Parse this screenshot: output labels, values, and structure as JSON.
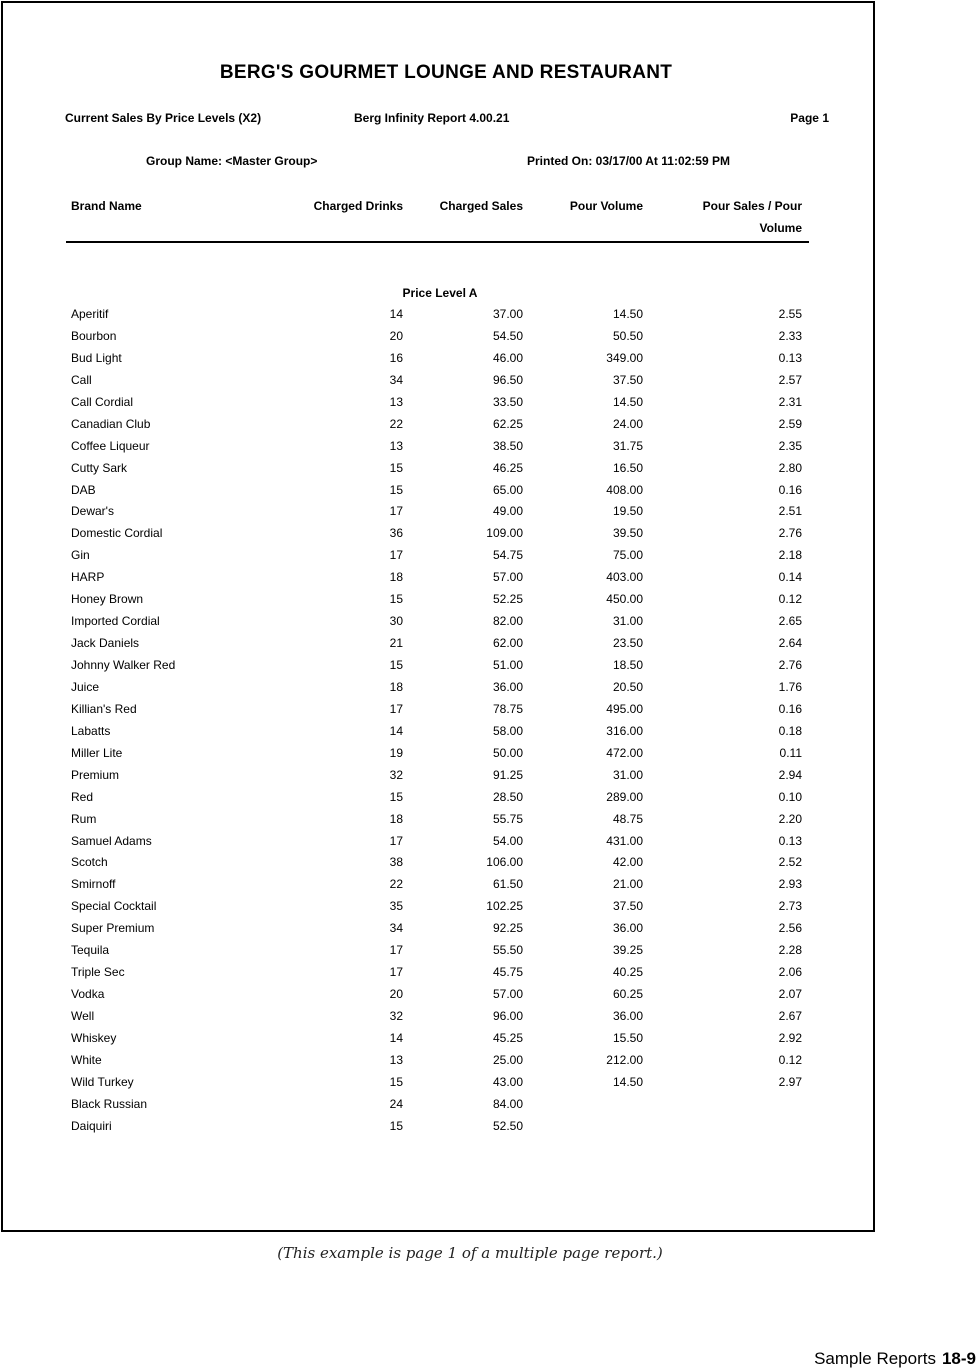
{
  "report": {
    "title": "BERG'S GOURMET LOUNGE AND RESTAURANT",
    "subtitle": "Current Sales By Price Levels (X2)",
    "software": "Berg Infinity Report 4.00.21",
    "page": "Page 1",
    "group_name": "Group Name: <Master Group>",
    "printed_on": "Printed On: 03/17/00 At 11:02:59 PM"
  },
  "table": {
    "columns": [
      "Brand Name",
      "Charged Drinks",
      "Charged Sales",
      "Pour Volume",
      "Pour Sales / Pour",
      "Volume"
    ],
    "section": "Price Level A",
    "rows": [
      {
        "name": "Aperitif",
        "drinks": "14",
        "sales": "37.00",
        "volume": "14.50",
        "ratio": "2.55"
      },
      {
        "name": "Bourbon",
        "drinks": "20",
        "sales": "54.50",
        "volume": "50.50",
        "ratio": "2.33"
      },
      {
        "name": "Bud Light",
        "drinks": "16",
        "sales": "46.00",
        "volume": "349.00",
        "ratio": "0.13"
      },
      {
        "name": "Call",
        "drinks": "34",
        "sales": "96.50",
        "volume": "37.50",
        "ratio": "2.57"
      },
      {
        "name": "Call Cordial",
        "drinks": "13",
        "sales": "33.50",
        "volume": "14.50",
        "ratio": "2.31"
      },
      {
        "name": "Canadian Club",
        "drinks": "22",
        "sales": "62.25",
        "volume": "24.00",
        "ratio": "2.59"
      },
      {
        "name": "Coffee Liqueur",
        "drinks": "13",
        "sales": "38.50",
        "volume": "31.75",
        "ratio": "2.35"
      },
      {
        "name": "Cutty Sark",
        "drinks": "15",
        "sales": "46.25",
        "volume": "16.50",
        "ratio": "2.80"
      },
      {
        "name": "DAB",
        "drinks": "15",
        "sales": "65.00",
        "volume": "408.00",
        "ratio": "0.16"
      },
      {
        "name": "Dewar's",
        "drinks": "17",
        "sales": "49.00",
        "volume": "19.50",
        "ratio": "2.51"
      },
      {
        "name": "Domestic Cordial",
        "drinks": "36",
        "sales": "109.00",
        "volume": "39.50",
        "ratio": "2.76"
      },
      {
        "name": "Gin",
        "drinks": "17",
        "sales": "54.75",
        "volume": "75.00",
        "ratio": "2.18"
      },
      {
        "name": "HARP",
        "drinks": "18",
        "sales": "57.00",
        "volume": "403.00",
        "ratio": "0.14"
      },
      {
        "name": "Honey Brown",
        "drinks": "15",
        "sales": "52.25",
        "volume": "450.00",
        "ratio": "0.12"
      },
      {
        "name": "Imported Cordial",
        "drinks": "30",
        "sales": "82.00",
        "volume": "31.00",
        "ratio": "2.65"
      },
      {
        "name": "Jack Daniels",
        "drinks": "21",
        "sales": "62.00",
        "volume": "23.50",
        "ratio": "2.64"
      },
      {
        "name": "Johnny Walker Red",
        "drinks": "15",
        "sales": "51.00",
        "volume": "18.50",
        "ratio": "2.76"
      },
      {
        "name": "Juice",
        "drinks": "18",
        "sales": "36.00",
        "volume": "20.50",
        "ratio": "1.76"
      },
      {
        "name": "Killian's Red",
        "drinks": "17",
        "sales": "78.75",
        "volume": "495.00",
        "ratio": "0.16"
      },
      {
        "name": "Labatts",
        "drinks": "14",
        "sales": "58.00",
        "volume": "316.00",
        "ratio": "0.18"
      },
      {
        "name": "Miller Lite",
        "drinks": "19",
        "sales": "50.00",
        "volume": "472.00",
        "ratio": "0.11"
      },
      {
        "name": "Premium",
        "drinks": "32",
        "sales": "91.25",
        "volume": "31.00",
        "ratio": "2.94"
      },
      {
        "name": "Red",
        "drinks": "15",
        "sales": "28.50",
        "volume": "289.00",
        "ratio": "0.10"
      },
      {
        "name": "Rum",
        "drinks": "18",
        "sales": "55.75",
        "volume": "48.75",
        "ratio": "2.20"
      },
      {
        "name": "Samuel Adams",
        "drinks": "17",
        "sales": "54.00",
        "volume": "431.00",
        "ratio": "0.13"
      },
      {
        "name": "Scotch",
        "drinks": "38",
        "sales": "106.00",
        "volume": "42.00",
        "ratio": "2.52"
      },
      {
        "name": "Smirnoff",
        "drinks": "22",
        "sales": "61.50",
        "volume": "21.00",
        "ratio": "2.93"
      },
      {
        "name": "Special Cocktail",
        "drinks": "35",
        "sales": "102.25",
        "volume": "37.50",
        "ratio": "2.73"
      },
      {
        "name": "Super Premium",
        "drinks": "34",
        "sales": "92.25",
        "volume": "36.00",
        "ratio": "2.56"
      },
      {
        "name": "Tequila",
        "drinks": "17",
        "sales": "55.50",
        "volume": "39.25",
        "ratio": "2.28"
      },
      {
        "name": "Triple Sec",
        "drinks": "17",
        "sales": "45.75",
        "volume": "40.25",
        "ratio": "2.06"
      },
      {
        "name": "Vodka",
        "drinks": "20",
        "sales": "57.00",
        "volume": "60.25",
        "ratio": "2.07"
      },
      {
        "name": "Well",
        "drinks": "32",
        "sales": "96.00",
        "volume": "36.00",
        "ratio": "2.67"
      },
      {
        "name": "Whiskey",
        "drinks": "14",
        "sales": "45.25",
        "volume": "15.50",
        "ratio": "2.92"
      },
      {
        "name": "White",
        "drinks": "13",
        "sales": "25.00",
        "volume": "212.00",
        "ratio": "0.12"
      },
      {
        "name": "Wild Turkey",
        "drinks": "15",
        "sales": "43.00",
        "volume": "14.50",
        "ratio": "2.97"
      },
      {
        "name": "Black Russian",
        "drinks": "24",
        "sales": "84.00",
        "volume": "",
        "ratio": ""
      },
      {
        "name": "Daiquiri",
        "drinks": "15",
        "sales": "52.50",
        "volume": "",
        "ratio": ""
      }
    ]
  },
  "caption": "(This example is page 1 of a multiple page report.)",
  "footer": {
    "label": "Sample Reports",
    "page": "18-9"
  }
}
